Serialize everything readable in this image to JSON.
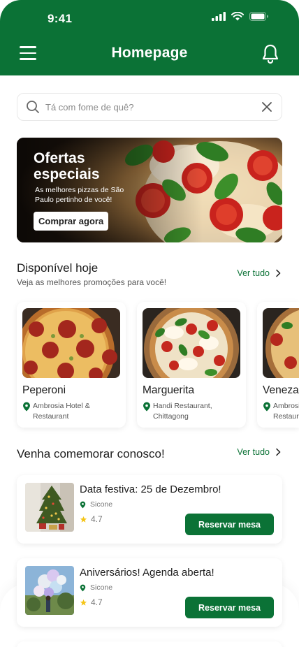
{
  "status_bar": {
    "time": "9:41"
  },
  "header": {
    "title": "Homepage"
  },
  "search": {
    "placeholder": "Tá com fome de quê?",
    "value": ""
  },
  "banner": {
    "title": "Ofertas especiais",
    "subtitle": "As melhores pizzas de São Paulo pertinho de você!",
    "button_label": "Comprar agora"
  },
  "available_today": {
    "title": "Disponível hoje",
    "subtitle": "Veja as melhores promoções para você!",
    "see_all": "Ver tudo",
    "items": [
      {
        "name": "Peperoni",
        "location": "Ambrosia Hotel & Restaurant"
      },
      {
        "name": "Marguerita",
        "location": "Handi Restaurant, Chittagong"
      },
      {
        "name": "Veneza",
        "location": "Ambrosia Hotel & Restaurant"
      }
    ]
  },
  "celebrate": {
    "title": "Venha comemorar conosco!",
    "see_all": "Ver tudo",
    "events": [
      {
        "title": "Data festiva: 25 de Dezembro!",
        "place": "Sicone",
        "rating": "4.7",
        "button_label": "Reservar mesa"
      },
      {
        "title": "Aniversários! Agenda aberta!",
        "place": "Sicone",
        "rating": "4.7",
        "button_label": "Reservar mesa"
      }
    ]
  },
  "colors": {
    "primary": "#0b7236",
    "accent_star": "#f5c518"
  }
}
